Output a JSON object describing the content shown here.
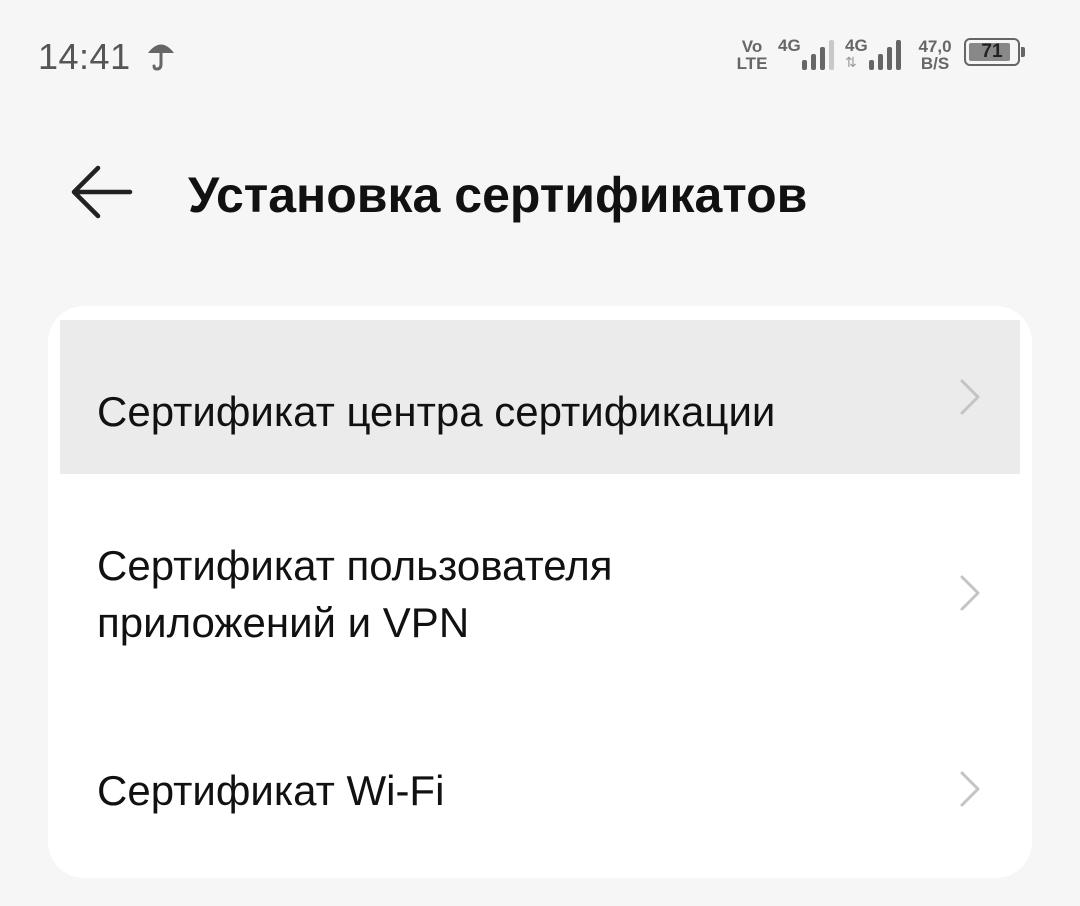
{
  "status_bar": {
    "time": "14:41",
    "volte_top": "Vo",
    "volte_bottom": "LTE",
    "sim1_network": "4G",
    "sim2_network": "4G",
    "sim2_arrows": "⇅",
    "speed_value": "47,0",
    "speed_unit": "B/S",
    "battery_percent": "71"
  },
  "header": {
    "title": "Установка сертификатов"
  },
  "items": [
    {
      "label": "Сертификат центра сертификации"
    },
    {
      "label_line1": "Сертификат пользователя",
      "label_line2": "приложений и VPN"
    },
    {
      "label": "Сертификат Wi-Fi"
    }
  ],
  "colors": {
    "background": "#f6f6f6",
    "card": "#ffffff",
    "pressed_row": "#ebebeb",
    "chevron": "#c4c4c4"
  }
}
